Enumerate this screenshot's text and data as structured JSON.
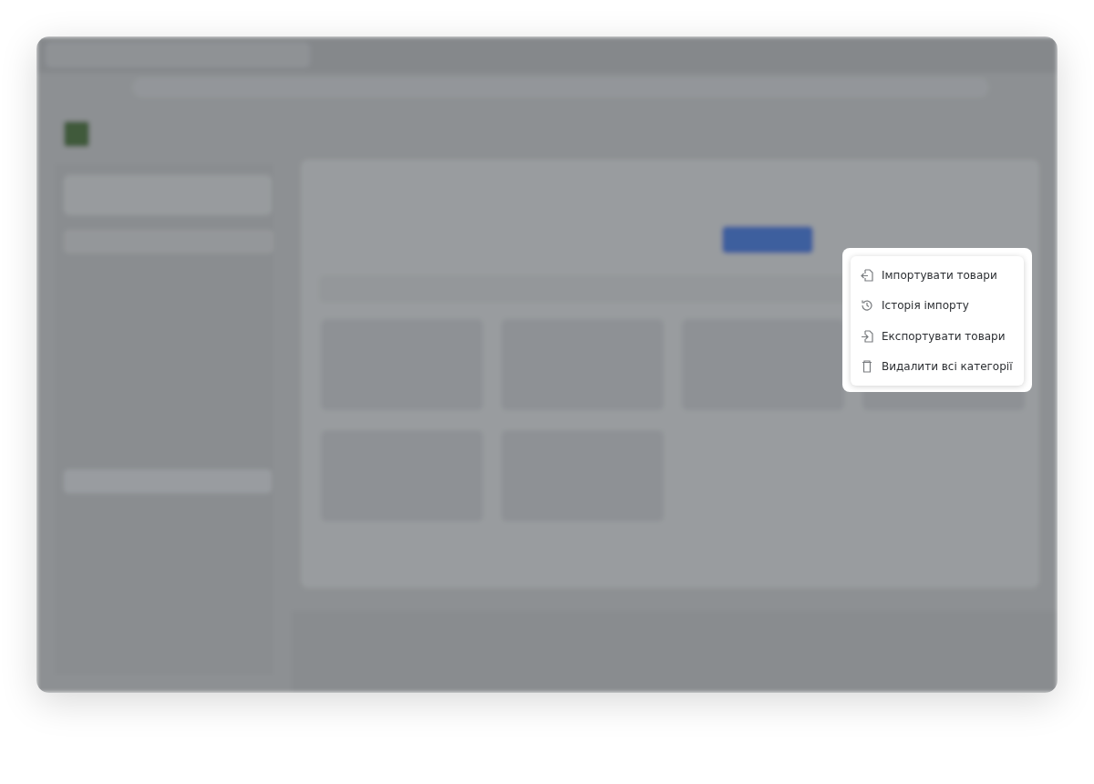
{
  "menu": {
    "items": [
      {
        "kind": "import",
        "label": "Імпортувати товари"
      },
      {
        "kind": "history",
        "label": "Історія імпорту"
      },
      {
        "kind": "export",
        "label": "Експортувати товари"
      },
      {
        "kind": "delete",
        "label": "Видалити всі категорії"
      }
    ]
  }
}
